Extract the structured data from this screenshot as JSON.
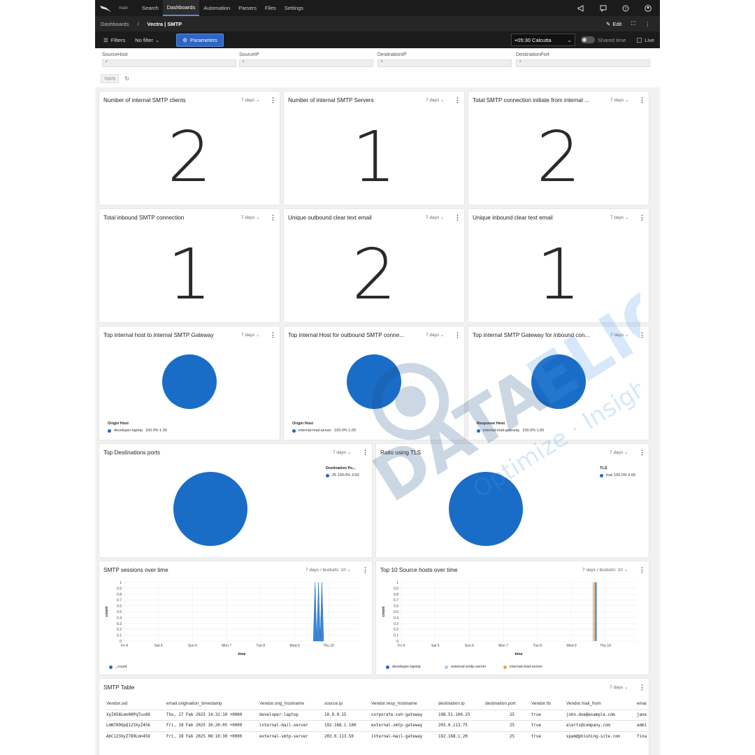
{
  "topnav": {
    "org": "main",
    "items": [
      "Search",
      "Dashboards",
      "Automation",
      "Parsers",
      "Files",
      "Settings"
    ],
    "active": "Dashboards"
  },
  "breadcrumb": {
    "root": "Dashboards",
    "sep": "/",
    "current": "Vectra | SMTP",
    "edit_label": "Edit"
  },
  "filterbar": {
    "filters_label": "Filters",
    "no_filter_label": "No filter",
    "parameters_label": "Parameters",
    "timezone": "+05:30 Calcutta",
    "shared_time_label": "Shared time",
    "live_label": "Live"
  },
  "params": {
    "fields": [
      {
        "label": "SourceHost",
        "value": "*"
      },
      {
        "label": "SourceIP",
        "value": "*"
      },
      {
        "label": "DestinationIP",
        "value": "*"
      },
      {
        "label": "DestinationPort",
        "value": "*"
      }
    ],
    "apply_label": "Apply"
  },
  "panels": {
    "p1": {
      "title": "Number of internal SMTP clients",
      "time": "7 days",
      "value": "2"
    },
    "p2": {
      "title": "Number of internal SMTP Servers",
      "time": "7 days",
      "value": "1"
    },
    "p3": {
      "title": "Total SMTP connection initiate from internal ...",
      "time": "7 days",
      "value": "2"
    },
    "p4": {
      "title": "Total inbound SMTP connection",
      "time": "7 days",
      "value": "1"
    },
    "p5": {
      "title": "Unique outbound clear text email",
      "time": "7 days",
      "value": "2"
    },
    "p6": {
      "title": "Unique inbound clear text email",
      "time": "7 days",
      "value": "1"
    },
    "p7": {
      "title": "Top internal host to internal SMTP Gateway",
      "time": "7 days",
      "legend_title": "Origin Host",
      "legend_item": "developer-laptop",
      "legend_value": "100.0% 1.00"
    },
    "p8": {
      "title": "Top internal Host for outbound SMTP conne...",
      "time": "7 days",
      "legend_title": "Origin Host",
      "legend_item": "internal-mail-server",
      "legend_value": "100.0% 1.00"
    },
    "p9": {
      "title": "Top internal SMTP Gateway for inbound con...",
      "time": "7 days",
      "legend_title": "Response Host",
      "legend_item": "internal-mail-gateway",
      "legend_value": "100.0% 1.00"
    },
    "p10": {
      "title": "Top Destinations ports",
      "time": "7 days",
      "legend_title": "Destination Po...",
      "legend_item": "25 100.0% 3.00"
    },
    "p11": {
      "title": "Ratio using TLS",
      "time": "7 days",
      "legend_title": "TLS",
      "legend_item": "true 100.0% 3.00"
    },
    "p12": {
      "title": "SMTP sessions over time",
      "time": "7 days / buckets: 1h",
      "legend_item": "_count"
    },
    "p13": {
      "title": "Top 10 Source hosts over time",
      "time": "7 days / buckets: 1h",
      "legend_items": [
        "developer-laptop",
        "external-smtp-server",
        "internal-mail-server"
      ]
    },
    "p14": {
      "title": "SMTP Table",
      "time": "7 days"
    }
  },
  "colors": {
    "accent": "#2f66c4",
    "pie": "#1a6dc7",
    "series1": "#1a6dc7",
    "series2": "#a9cdea",
    "series3": "#f0a04b"
  },
  "chart_data": [
    {
      "type": "area",
      "title": "SMTP sessions over time",
      "xlabel": "time",
      "ylabel": "count",
      "ylim": [
        0,
        1
      ],
      "yticks": [
        "0",
        "0.1",
        "0.2",
        "0.3",
        "0.4",
        "0.5",
        "0.6",
        "0.7",
        "0.8",
        "0.9",
        "1"
      ],
      "xticks": [
        "Fri 4",
        "Sat 5",
        "Sun 6",
        "Mon 7",
        "Tue 8",
        "Wed 9",
        "Thu 10"
      ],
      "series": [
        {
          "name": "_count",
          "spikes": [
            9.6,
            9.7,
            9.8
          ],
          "values": [
            1,
            1,
            1
          ]
        }
      ]
    },
    {
      "type": "line",
      "title": "Top 10 Source hosts over time",
      "xlabel": "time",
      "ylabel": "count",
      "ylim": [
        0,
        1
      ],
      "yticks": [
        "0",
        "0.1",
        "0.2",
        "0.3",
        "0.4",
        "0.5",
        "0.6",
        "0.7",
        "0.8",
        "0.9",
        "1"
      ],
      "xticks": [
        "Fri 4",
        "Sat 5",
        "Sun 6",
        "Mon 7",
        "Tue 8",
        "Wed 9",
        "Thu 10"
      ],
      "series": [
        {
          "name": "developer-laptop",
          "x": 9.72,
          "value": 1
        },
        {
          "name": "external-smtp-server",
          "x": 9.64,
          "value": 1
        },
        {
          "name": "internal-mail-server",
          "x": 9.68,
          "value": 1
        }
      ]
    }
  ],
  "table": {
    "columns": [
      "Vendor.uid",
      "email.origination_timestamp",
      "Vendor.orig_hostname",
      "source.ip",
      "Vendor.resp_hostname",
      "destination.ip",
      "destination.port",
      "Vendor.tls",
      "Vendor.mail_from",
      "emai"
    ],
    "rows": [
      [
        "XyZ456Lmn00PqTuv89",
        "Thu, 27 Feb 2025 14:32:10 +0000",
        "developer-laptop",
        "10.0.0.15",
        "corporate-ssh-gateway",
        "198.51.100.25",
        "25",
        "true",
        "john.doe@example.com",
        "jane"
      ],
      [
        "LmN789OpQ123XyZ456",
        "Fri, 28 Feb 2025 10:20:05 +0000",
        "internal-mail-server",
        "192.168.1.100",
        "external-smtp-gateway",
        "203.0.113.75",
        "25",
        "true",
        "alerts@company.com",
        "admi"
      ],
      [
        "AbC123XyZ789Lmn456",
        "Fri, 28 Feb 2025 08:10:30 +0000",
        "external-smtp-server",
        "203.0.113.50",
        "internal-mail-gateway",
        "192.168.1.20",
        "25",
        "true",
        "spam@phishing-site.com",
        "fina"
      ]
    ]
  },
  "watermark": {
    "brand": "DATAELICIT",
    "tagline": "Optimize · Insights · Action"
  }
}
